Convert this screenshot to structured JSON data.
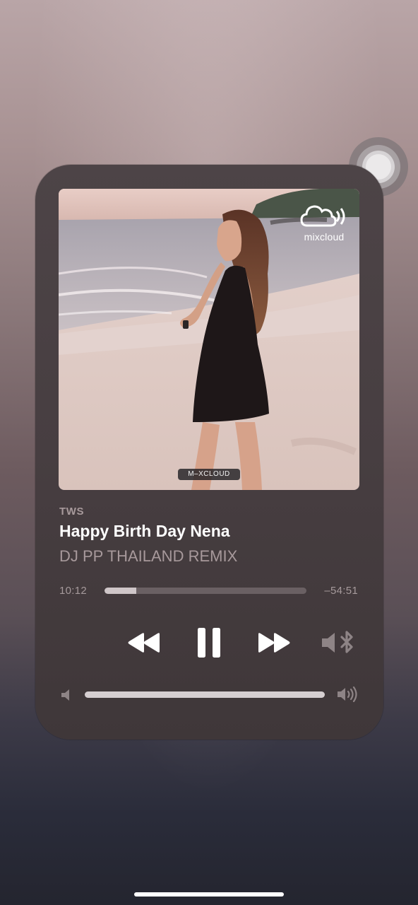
{
  "player": {
    "artist": "TWS",
    "title": "Happy Birth Day Nena",
    "subtitle": "DJ PP THAILAND REMIX",
    "elapsed": "10:12",
    "remaining": "–54:51",
    "progress": 0.157,
    "volume": 1.0,
    "state": "playing"
  },
  "artwork": {
    "logo_text": "mixcloud",
    "watermark": "M–XCLOUD"
  },
  "icons": {
    "rewind": "rewind-icon",
    "pause": "pause-icon",
    "fast_forward": "fast-forward-icon",
    "audio_output": "bluetooth-speaker-icon",
    "volume_low": "speaker-low-icon",
    "volume_high": "speaker-high-icon",
    "assistive_touch": "assistive-touch-icon"
  },
  "colors": {
    "accent": "#ffffff",
    "secondary_text": "#a89a9c",
    "panel": "#473e41"
  }
}
